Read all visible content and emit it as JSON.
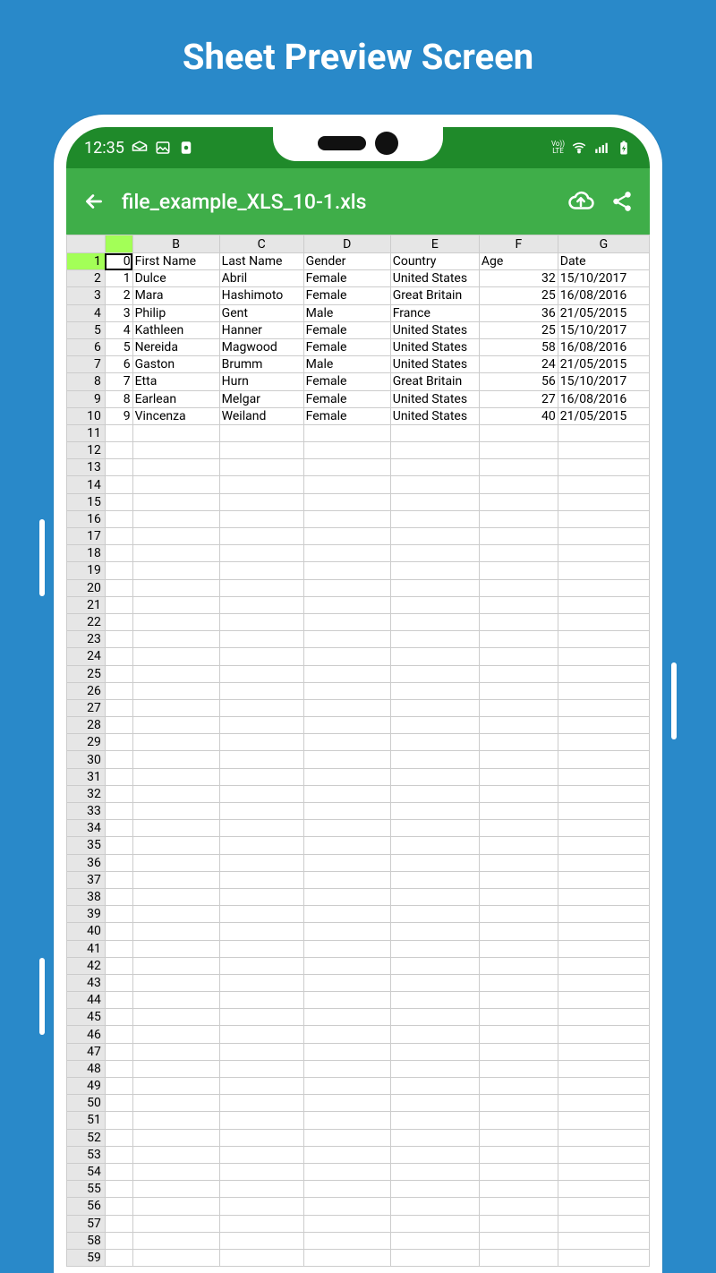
{
  "banner": "Sheet Preview Screen",
  "statusbar": {
    "time": "12:35",
    "lte": "Vo))\nLTE"
  },
  "appbar": {
    "title": "file_example_XLS_10-1.xls"
  },
  "sheet": {
    "col_headers": [
      "",
      "",
      "B",
      "C",
      "D",
      "E",
      "F",
      "G"
    ],
    "selected_cell": "A1",
    "rows_total": 59,
    "data": [
      {
        "n": 1,
        "a": "0",
        "b": "First Name",
        "c": "Last Name",
        "d": "Gender",
        "e": "Country",
        "f": "Age",
        "g": "Date"
      },
      {
        "n": 2,
        "a": "1",
        "b": "Dulce",
        "c": "Abril",
        "d": "Female",
        "e": "United States",
        "f": "32",
        "g": "15/10/2017"
      },
      {
        "n": 3,
        "a": "2",
        "b": "Mara",
        "c": "Hashimoto",
        "d": "Female",
        "e": "Great Britain",
        "f": "25",
        "g": "16/08/2016"
      },
      {
        "n": 4,
        "a": "3",
        "b": "Philip",
        "c": "Gent",
        "d": "Male",
        "e": "France",
        "f": "36",
        "g": "21/05/2015"
      },
      {
        "n": 5,
        "a": "4",
        "b": "Kathleen",
        "c": "Hanner",
        "d": "Female",
        "e": "United States",
        "f": "25",
        "g": "15/10/2017"
      },
      {
        "n": 6,
        "a": "5",
        "b": "Nereida",
        "c": "Magwood",
        "d": "Female",
        "e": "United States",
        "f": "58",
        "g": "16/08/2016"
      },
      {
        "n": 7,
        "a": "6",
        "b": "Gaston",
        "c": "Brumm",
        "d": "Male",
        "e": "United States",
        "f": "24",
        "g": "21/05/2015"
      },
      {
        "n": 8,
        "a": "7",
        "b": "Etta",
        "c": "Hurn",
        "d": "Female",
        "e": "Great Britain",
        "f": "56",
        "g": "15/10/2017"
      },
      {
        "n": 9,
        "a": "8",
        "b": "Earlean",
        "c": "Melgar",
        "d": "Female",
        "e": "United States",
        "f": "27",
        "g": "16/08/2016"
      },
      {
        "n": 10,
        "a": "9",
        "b": "Vincenza",
        "c": "Weiland",
        "d": "Female",
        "e": "United States",
        "f": "40",
        "g": "21/05/2015"
      }
    ]
  }
}
